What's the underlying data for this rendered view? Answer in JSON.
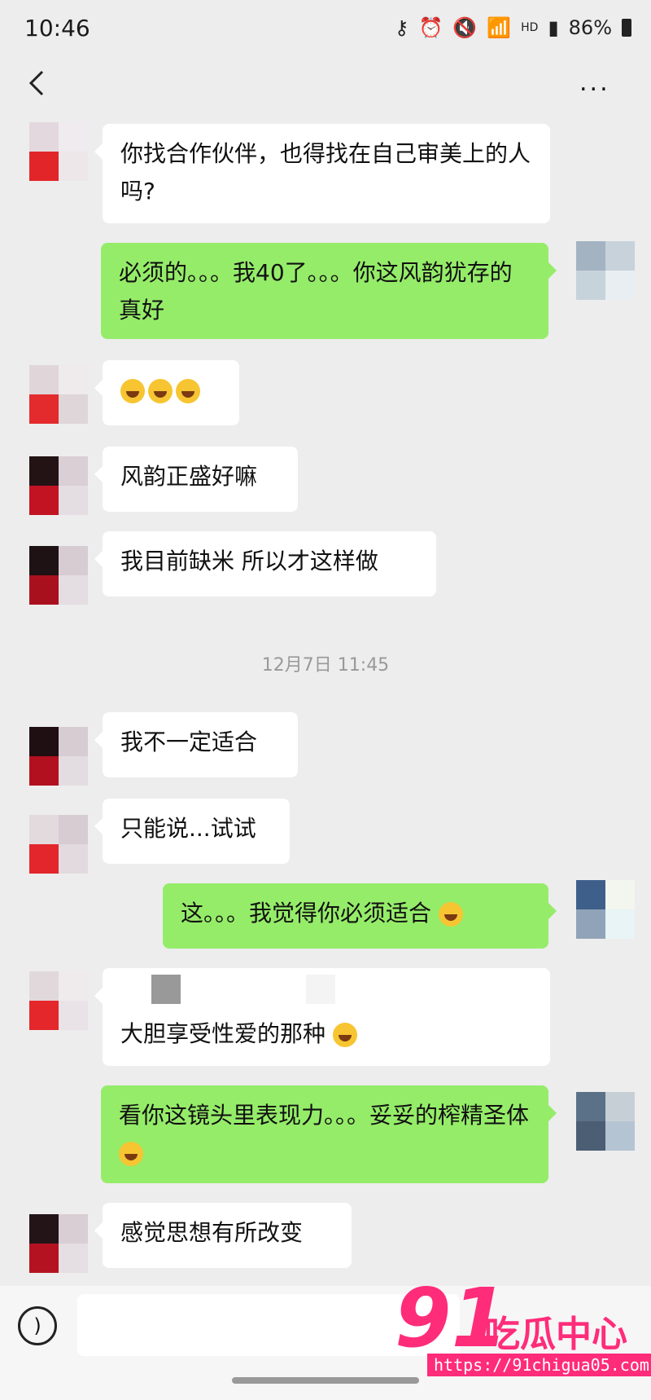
{
  "status": {
    "time": "10:46",
    "network": "HD",
    "battery": "86%"
  },
  "nav": {
    "back_icon": "chevron-left-icon",
    "more_label": "..."
  },
  "messages": [
    {
      "side": "left",
      "text": "你找合作伙伴，也得找在自己审美上的人吗?"
    },
    {
      "side": "right",
      "text": "必须的。。。我40了。。。你这风韵犹存的真好"
    },
    {
      "side": "left",
      "text": ""
    },
    {
      "side": "left",
      "text": "风韵正盛好嘛"
    },
    {
      "side": "left",
      "text": "我目前缺米 所以才这样做"
    },
    {
      "side": "left",
      "text": "我不一定适合"
    },
    {
      "side": "left",
      "text": "只能说...试试"
    },
    {
      "side": "right",
      "text": "这。。。我觉得你必须适合"
    },
    {
      "side": "left",
      "text": "大胆享受性爱的那种"
    },
    {
      "side": "right",
      "text": "看你这镜头里表现力。。。妥妥的榨精圣体"
    },
    {
      "side": "left",
      "text": "感觉思想有所改变"
    }
  ],
  "timestamp": "12月7日 11:45",
  "watermark": {
    "brand_number": "91",
    "brand_text": "吃瓜中心",
    "url": "https://91chigua05.com"
  },
  "colors": {
    "bubble_left": "#ffffff",
    "bubble_right": "#95ec69",
    "background": "#ededed",
    "watermark": "#ff2c7a"
  }
}
